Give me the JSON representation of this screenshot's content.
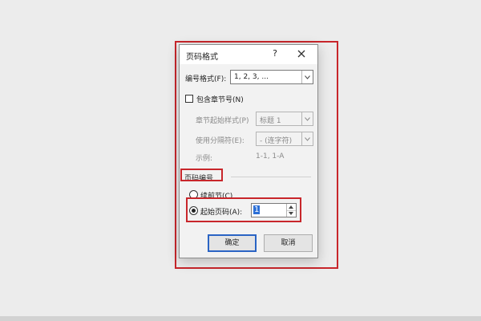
{
  "dialog": {
    "title": "页码格式",
    "help": "?",
    "number_format": {
      "label": "编号格式(F):",
      "value": "1, 2, 3, ..."
    },
    "include_chapter": {
      "label": "包含章节号(N)",
      "checked": false
    },
    "chapter_style": {
      "label": "章节起始样式(P)",
      "value": "标题 1"
    },
    "separator": {
      "label": "使用分隔符(E):",
      "value": "- (连字符)"
    },
    "example": {
      "label": "示例:",
      "value": "1-1, 1-A"
    },
    "page_numbering": {
      "section_label": "页码编号",
      "continue_label": "续前节(C)",
      "start_at_label": "起始页码(A):",
      "start_at_value": "1",
      "selected": "start_at"
    },
    "buttons": {
      "ok": "确定",
      "cancel": "取消"
    }
  },
  "colors": {
    "highlight": "#c8262b",
    "primary_button_border": "#2a64c4",
    "selection": "#2b6fd6"
  }
}
